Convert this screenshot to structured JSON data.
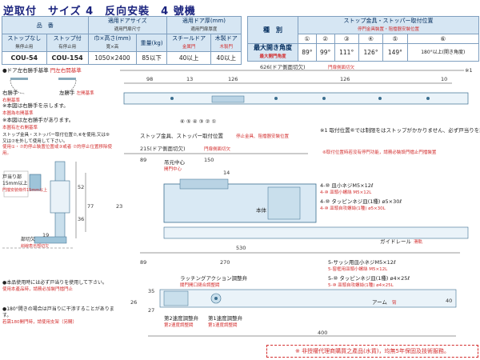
{
  "header": {
    "title": "逆取付　サイズ 4　反向安裝　4 號機"
  },
  "spec_table": {
    "col_stop_none": "ストップなし",
    "col_stop_none_cn": "無停止用",
    "col_stop_with": "ストップ付",
    "col_stop_with_cn": "有停止用",
    "group_code": "品　番",
    "group_door_size": "適用ドアサイズ",
    "group_door_size_cn": "適用門扉尺寸",
    "col_wh": "巾×高さ(mm)",
    "col_wh_cn": "寛×高",
    "col_weight": "重量(kg)",
    "group_door_thick": "適用ドア厚(mm)",
    "group_door_thick_cn": "適用門扉厚度",
    "col_steel": "スチールドア",
    "col_steel_cn": "金属門",
    "col_wood": "木製ドア",
    "col_wood_cn": "木製門",
    "row": {
      "code_none": "COU-54",
      "code_with": "COU-154",
      "wh": "1050×2400",
      "weight": "85以下",
      "steel": "40以上",
      "wood": "40以上"
    }
  },
  "angle_table": {
    "type_label": "種　別",
    "group": "ストップ金具・ストッパー取付位置",
    "group_cn": "停門金具裝置・阻擋器安裝位置",
    "positions": [
      "①",
      "②",
      "③",
      "④",
      "⑤",
      "⑥"
    ],
    "row_label": "最大開き角度",
    "row_label_cn": "最大開門角度",
    "values": [
      "89°",
      "99°",
      "111°",
      "126°",
      "149°",
      "180°以上(開き角度)"
    ]
  },
  "left_notes": {
    "hand_title": "●ドア左右勝手基準",
    "hand_title_cn": "門左右開基準",
    "right_hand": "右勝手",
    "right_hand_cn": "右開基準",
    "left_hand": "左勝手",
    "left_hand_cn": "左開基準",
    "fig_note1": "※本図は右勝手を示します。",
    "fig_note1_cn": "本圖為右開基準",
    "fig_note2": "※本図は左右勝手があります。",
    "fig_note2_cn": "本圖有左右開基準",
    "stop_note": "ストップ金具・ストッパー取付位置⑦,⑥を使用,又は⑨ 又は⑦を外して使用して下さい。",
    "stop_note_cn": "使用①・⑦的停止裝置位置或③或者 ⑦的停止位置移除使用。",
    "door_stop_label": "戸当り部",
    "door_stop_dim": "15mm以上",
    "door_stop_cn": "門擋安裝條件15mm以上",
    "stopper_label": "部切欠",
    "stopper_cn": "斜線表示部切欠",
    "product_note": "●本品使用時には必ず戸当りを使用して下さい。",
    "product_note_cn": "使用本產品時，請務必加裝門擋門止",
    "open180_note": "●180°開きの場合は戸当りに干渉することがあります。",
    "open180_cn": "若需180開門時，請使用支架（另購）"
  },
  "drawing": {
    "dim_626": "626(ドア側面切欠)",
    "dim_626_cn": "門扉側面切欠",
    "dim_215": "215(ドア側面切欠)",
    "dim_215_cn": "門扉側面切欠",
    "d98": "98",
    "d13": "13",
    "d126a": "126",
    "d126b": "126",
    "d10": "10",
    "d89": "89",
    "d270": "270",
    "d530": "530",
    "d150": "150",
    "d40": "40",
    "d14": "14",
    "d23": "23",
    "d52": "52",
    "d36": "36",
    "d77": "77",
    "d19": "19",
    "d400": "400",
    "d35": "35",
    "d27": "27",
    "d26": "26",
    "top_label": "ストップ金具、ストッパー取付位置",
    "top_label_cn": "停止金具、阻擋器安裝位置",
    "mark1": "※1",
    "note_right": "※1 取付位置⑥では制限をはストップがかかりません、必ず戸当りを設置して下さい。",
    "note_right_cn": "⑥取付位置時若没有停門功能，請務必裝設門檔止門擋裝置",
    "main_body": "本体",
    "main_body_cn": "本体",
    "guide_rail": "ガイドレール",
    "guide_rail_cn": "滑軌",
    "arm": "アーム",
    "arm_cn": "臂",
    "hinge_center": "吊元中心",
    "hinge_center_cn": "開門中心",
    "screw4a": "4-⑩ 皿小ネジM5×12ℓ",
    "screw4a_cn": "4-⑩ 皿頭小螺絲 M5×12L",
    "screw4b": "4-⑩ タッピンネジ皿(1種) ø5×30ℓ",
    "screw4b_cn": "4-⑩ 皿頭自攻螺絲(1種) ø5×30L",
    "screw5a": "5-サッシ用皿小ネジM5×12ℓ",
    "screw5a_cn": "5-窗框用皿頭小螺絲 M5×12L",
    "screw5b": "5-⑩ タッピンネジ皿(1種) ø4×25ℓ",
    "screw5b_cn": "5-⑩ 皿頭自攻螺絲(1種) ø4×25L",
    "latch_adj": "ラッチングアクション調整弁",
    "latch_adj_cn": "關門開口閉合調整閥",
    "speed1": "第1速度調整弁",
    "speed1_cn": "第1速度調整閥",
    "speed2": "第2速度調整弁",
    "speed2_cn": "第2速度調整閥"
  },
  "footer": {
    "text": "※ 非授權代理商購買之產品(水貨)，均無5年保固及技術服務。"
  }
}
